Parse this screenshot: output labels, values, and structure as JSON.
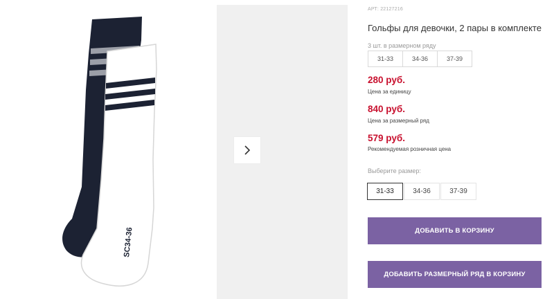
{
  "product": {
    "sku": "АРТ: 22127216",
    "title": "Гольфы для девочки, 2 пары в комплекте",
    "image_sock_label": "SC34-36"
  },
  "size_row": {
    "hint": "3 шт. в размерном ряду",
    "sizes": [
      "31-33",
      "34-36",
      "37-39"
    ]
  },
  "prices": {
    "unit_price": "280 руб.",
    "unit_label": "Цена за единицу",
    "row_price": "840 руб.",
    "row_label": "Цена за размерный ряд",
    "retail_price": "579 руб.",
    "retail_label": "Рекомендуемая розничная цена"
  },
  "size_select": {
    "label": "Выберите размер:",
    "options": [
      "31-33",
      "34-36",
      "37-39"
    ],
    "selected": "31-33"
  },
  "actions": {
    "add_to_cart": "ДОБАВИТЬ В КОРЗИНУ",
    "add_row_to_cart": "ДОБАВИТЬ РАЗМЕРНЫЙ РЯД В КОРЗИНУ"
  },
  "colors": {
    "accent": "#7b62a3",
    "price": "#c8102e",
    "navy_sock": "#1c2233"
  },
  "icons": {
    "gallery_next": "chevron-right-icon"
  }
}
